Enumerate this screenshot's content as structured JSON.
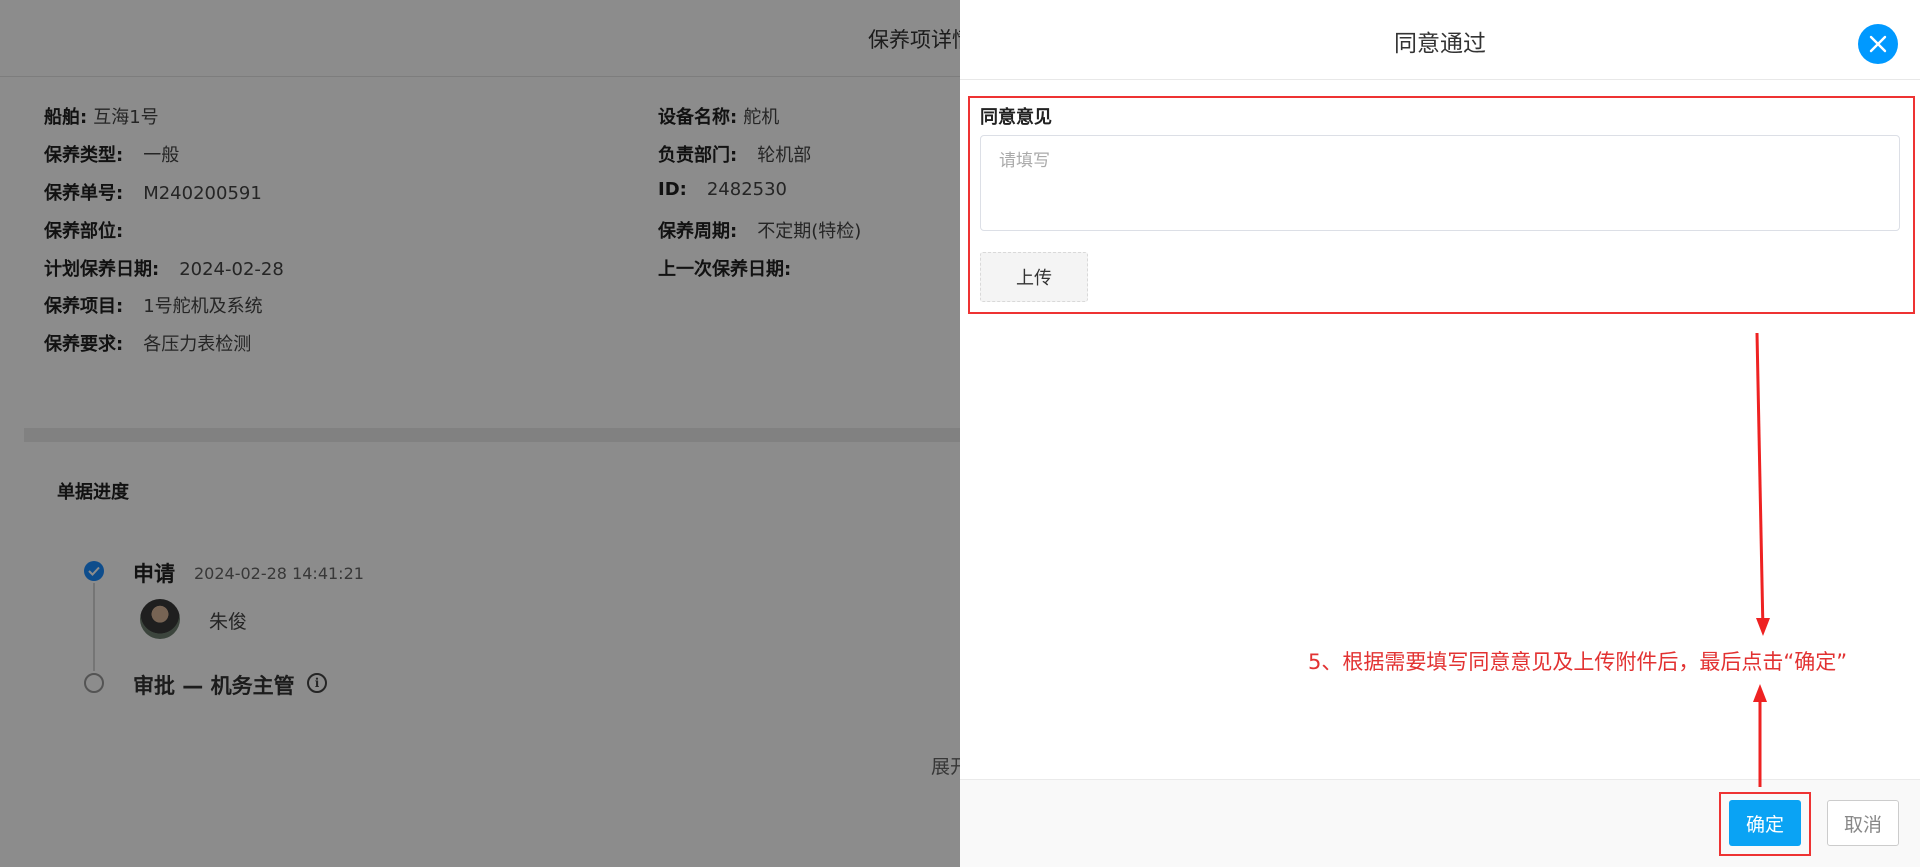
{
  "background": {
    "title": "保养项详情",
    "left_fields": [
      {
        "label": "船舶:",
        "value": "互海1号"
      },
      {
        "label": "保养类型:",
        "value": "一般"
      },
      {
        "label": "保养单号:",
        "value": "M240200591"
      },
      {
        "label": "保养部位:",
        "value": ""
      },
      {
        "label": "计划保养日期:",
        "value": "2024-02-28"
      },
      {
        "label": "保养项目:",
        "value": "1号舵机及系统"
      },
      {
        "label": "保养要求:",
        "value": "各压力表检测"
      }
    ],
    "right_fields": [
      {
        "label": "设备名称:",
        "value": "舵机"
      },
      {
        "label": "负责部门:",
        "value": "轮机部"
      },
      {
        "label": "ID:",
        "value": "2482530"
      },
      {
        "label": "保养周期:",
        "value": "不定期(特检)"
      },
      {
        "label": "上一次保养日期:",
        "value": ""
      }
    ],
    "progress_title": "单据进度",
    "steps": [
      {
        "title": "申请",
        "time": "2024-02-28 14:41:21",
        "user": "朱俊",
        "status": "done"
      },
      {
        "title": "审批 — 机务主管",
        "status": "pending"
      }
    ],
    "expand_text": "展开"
  },
  "drawer": {
    "title": "同意通过",
    "form_label": "同意意见",
    "textarea_placeholder": "请填写",
    "textarea_value": "",
    "upload_label": "上传",
    "confirm_label": "确定",
    "cancel_label": "取消"
  },
  "annotation": {
    "text": "5、根据需要填写同意意见及上传附件后，最后点击“确定”",
    "color": "#e23232"
  },
  "colors": {
    "accent": "#0aa3f4",
    "close_button": "#0099ff",
    "highlight": "#ee3333",
    "step_done": "#1a8cff"
  }
}
